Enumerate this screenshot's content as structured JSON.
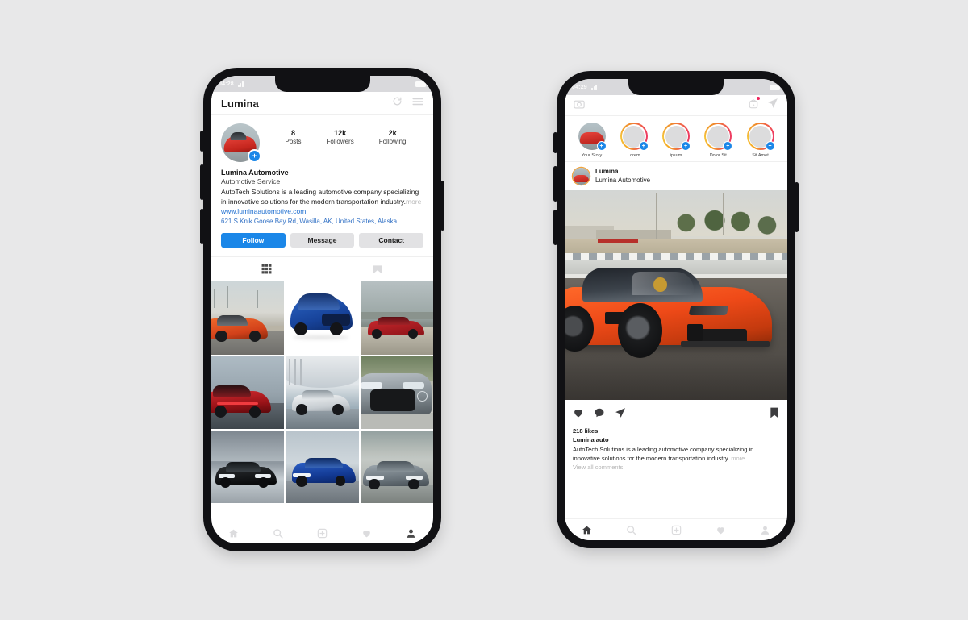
{
  "phone1": {
    "status_bar": {
      "time": "04:28",
      "signal_icon": "signal-bars-icon",
      "battery_icon": "battery-icon"
    },
    "header": {
      "title": "Lumina",
      "refresh_icon": "refresh-icon",
      "menu_icon": "hamburger-menu-icon"
    },
    "profile": {
      "avatar_icon": "profile-avatar",
      "avatar_badge": "+",
      "stats": [
        {
          "number": "8",
          "label": "Posts"
        },
        {
          "number": "12k",
          "label": "Followers"
        },
        {
          "number": "2k",
          "label": "Following"
        }
      ],
      "name": "Lumina Automotive",
      "category": "Automotive Service",
      "description": "AutoTech Solutions is a leading automotive company specializing in innovative solutions for the modern transportation industry.",
      "description_more": "more",
      "website": "www.luminaautomotive.com",
      "address": "621 S Knik Goose Bay Rd, Wasilla, AK, United States, Alaska",
      "buttons": [
        {
          "label": "Follow",
          "style": "primary"
        },
        {
          "label": "Message",
          "style": "secondary"
        },
        {
          "label": "Contact",
          "style": "secondary"
        }
      ]
    },
    "tabs": [
      {
        "name": "grid-tab",
        "icon": "grid-icon",
        "active": true
      },
      {
        "name": "tagged-tab",
        "icon": "tagged-person-icon",
        "active": false
      }
    ],
    "grid_posts": [
      {
        "alt": "orange-sports-car-on-track",
        "scene": "sky-desert",
        "car_color": "#e8572a",
        "car_color2": "#b33a13"
      },
      {
        "alt": "blue-suv-studio-shot",
        "scene": "sky-studio",
        "car_color": "#1f4fa8",
        "car_color2": "#123270"
      },
      {
        "alt": "red-sedan-desert-road",
        "scene": "sky-mount",
        "car_color": "#b31f24",
        "car_color2": "#7a1015"
      },
      {
        "alt": "red-sedan-rear-view",
        "scene": "sky-blur",
        "car_color": "#c21e22",
        "car_color2": "#7d0d11"
      },
      {
        "alt": "white-sedan-under-bridge",
        "scene": "sky-arch",
        "car_color": "#e6e9ec",
        "car_color2": "#aab2b9"
      },
      {
        "alt": "silver-sedan-front-grille",
        "scene": "sky-green",
        "car_color": "#9aa1a6",
        "car_color2": "#5f666b"
      },
      {
        "alt": "black-sedan-front",
        "scene": "sky-tunnel",
        "car_color": "#232629",
        "car_color2": "#0e1012"
      },
      {
        "alt": "blue-sedan-front-angle",
        "scene": "sky-road",
        "car_color": "#1b44a4",
        "car_color2": "#0e2a6e"
      },
      {
        "alt": "grey-sedan-front",
        "scene": "sky-city",
        "car_color": "#7f8a91",
        "car_color2": "#4d565c"
      }
    ],
    "bottom_nav": [
      {
        "name": "nav-home",
        "icon": "home-icon",
        "active": false
      },
      {
        "name": "nav-search",
        "icon": "search-icon",
        "active": false
      },
      {
        "name": "nav-add",
        "icon": "add-square-icon",
        "active": false
      },
      {
        "name": "nav-activity",
        "icon": "heart-icon",
        "active": false
      },
      {
        "name": "nav-profile",
        "icon": "person-icon",
        "active": true
      }
    ]
  },
  "phone2": {
    "status_bar": {
      "time": "04:29",
      "signal_icon": "signal-bars-icon",
      "battery_icon": "battery-icon"
    },
    "header": {
      "camera_icon": "camera-icon",
      "igtv_icon": "igtv-icon",
      "igtv_has_notification": true,
      "direct_icon": "paper-plane-icon"
    },
    "stories": [
      {
        "label": "Your Story",
        "has_ring": false,
        "has_badge": true,
        "has_photo": true
      },
      {
        "label": "Lorem",
        "has_ring": true,
        "has_badge": true,
        "has_photo": false
      },
      {
        "label": "ipsum",
        "has_ring": true,
        "has_badge": true,
        "has_photo": false
      },
      {
        "label": "Dolor Sit",
        "has_ring": true,
        "has_badge": true,
        "has_photo": false
      },
      {
        "label": "Sit Amet",
        "has_ring": true,
        "has_badge": true,
        "has_photo": false
      }
    ],
    "post": {
      "author": "Lumina",
      "subtitle": "Lumina Automotive",
      "image_alt": "orange-lamborghini-huracan-on-race-track",
      "like_icon": "heart-icon",
      "comment_icon": "comment-bubble-icon",
      "share_icon": "paper-plane-icon",
      "save_icon": "bookmark-icon",
      "likes": "218 likes",
      "caption_user": "Lumina auto",
      "caption_text": "AutoTech Solutions is a leading automotive company specializing in innovative solutions for the modern transportation industry..",
      "caption_more": "more",
      "view_comments": "View all comments"
    },
    "bottom_nav": [
      {
        "name": "nav-home",
        "icon": "home-icon",
        "active": true
      },
      {
        "name": "nav-search",
        "icon": "search-icon",
        "active": false
      },
      {
        "name": "nav-add",
        "icon": "add-square-icon",
        "active": false
      },
      {
        "name": "nav-activity",
        "icon": "heart-icon",
        "active": false
      },
      {
        "name": "nav-profile",
        "icon": "person-icon",
        "active": false
      }
    ]
  },
  "theme": {
    "background": "#e8e8e9",
    "accent_blue": "#1b87e8",
    "link_blue": "#1f6fd0",
    "story_gradient_start": "#f5a623",
    "story_gradient_end": "#ef3d61",
    "notification_dot": "#f0245c"
  }
}
